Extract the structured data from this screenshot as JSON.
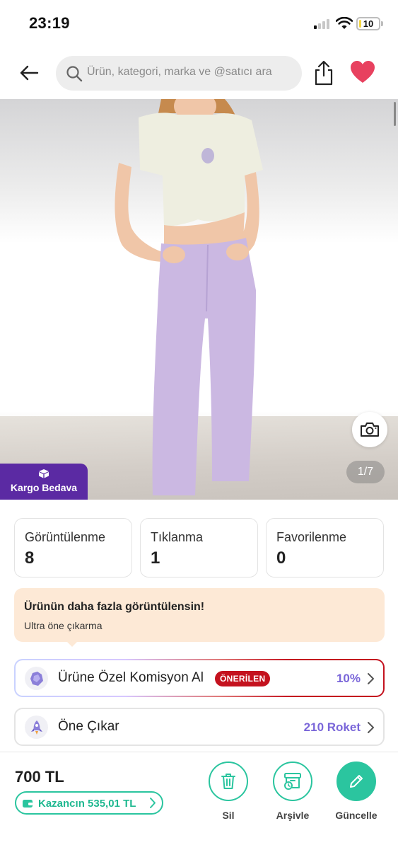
{
  "status_bar": {
    "time": "23:19",
    "battery": "10"
  },
  "header": {
    "search_placeholder": "Ürün, kategori, marka ve @satıcı ara"
  },
  "image": {
    "counter": "1/7",
    "badge": "Kargo Bedava"
  },
  "stats": [
    {
      "label": "Görüntülenme",
      "value": "8"
    },
    {
      "label": "Tıklanma",
      "value": "1"
    },
    {
      "label": "Favorilenme",
      "value": "0"
    }
  ],
  "promo": {
    "title": "Ürünün daha fazla görüntülensin!",
    "subtitle": "Ultra öne çıkarma"
  },
  "commission": {
    "label": "Ürüne Özel Komisyon Al",
    "badge": "ÖNERİLEN",
    "value": "10%"
  },
  "boost": {
    "label": "Öne Çıkar",
    "value": "210 Roket"
  },
  "bottom": {
    "price": "700 TL",
    "earnings": "Kazancın 535,01 TL",
    "actions": {
      "delete": "Sil",
      "archive": "Arşivle",
      "update": "Güncelle"
    }
  },
  "colors": {
    "accent": "#2bc59f",
    "purple": "#5b2aa3",
    "red": "#c4121e",
    "link": "#7a66d9",
    "heart": "#e8415f"
  }
}
